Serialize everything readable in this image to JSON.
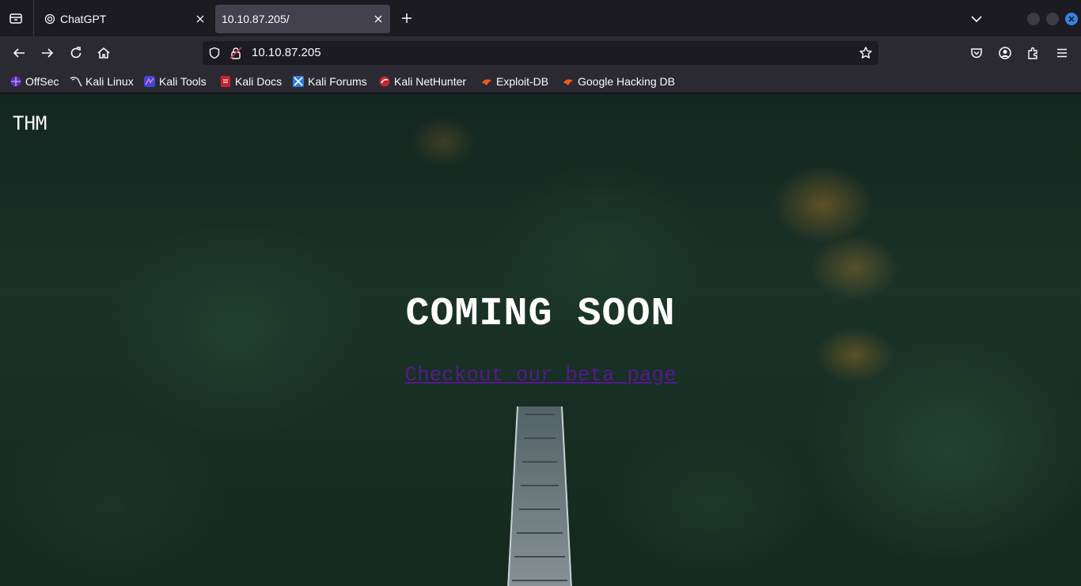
{
  "browser": {
    "tabs": [
      {
        "title": "ChatGPT",
        "favicon": "openai-icon",
        "active": false
      },
      {
        "title": "10.10.87.205/",
        "active": true
      }
    ],
    "url": "10.10.87.205",
    "bookmarks": [
      {
        "label": "OffSec",
        "icon": "offsec-icon"
      },
      {
        "label": "Kali Linux",
        "icon": "kali-dragon-icon"
      },
      {
        "label": "Kali Tools",
        "icon": "kali-tools-icon"
      },
      {
        "label": "Kali Docs",
        "icon": "kali-docs-icon"
      },
      {
        "label": "Kali Forums",
        "icon": "kali-forums-icon"
      },
      {
        "label": "Kali NetHunter",
        "icon": "kali-nethunter-icon"
      },
      {
        "label": "Exploit-DB",
        "icon": "exploit-db-icon"
      },
      {
        "label": "Google Hacking DB",
        "icon": "exploit-db-icon"
      }
    ],
    "colors": {
      "accent": "#3584e4",
      "toolbar": "#2b2a33",
      "tabstrip": "#1c1b22"
    }
  },
  "page": {
    "logo": "THM",
    "headline": "COMING SOON",
    "link_text": "Checkout our beta page",
    "link_color": "#551a8b"
  }
}
